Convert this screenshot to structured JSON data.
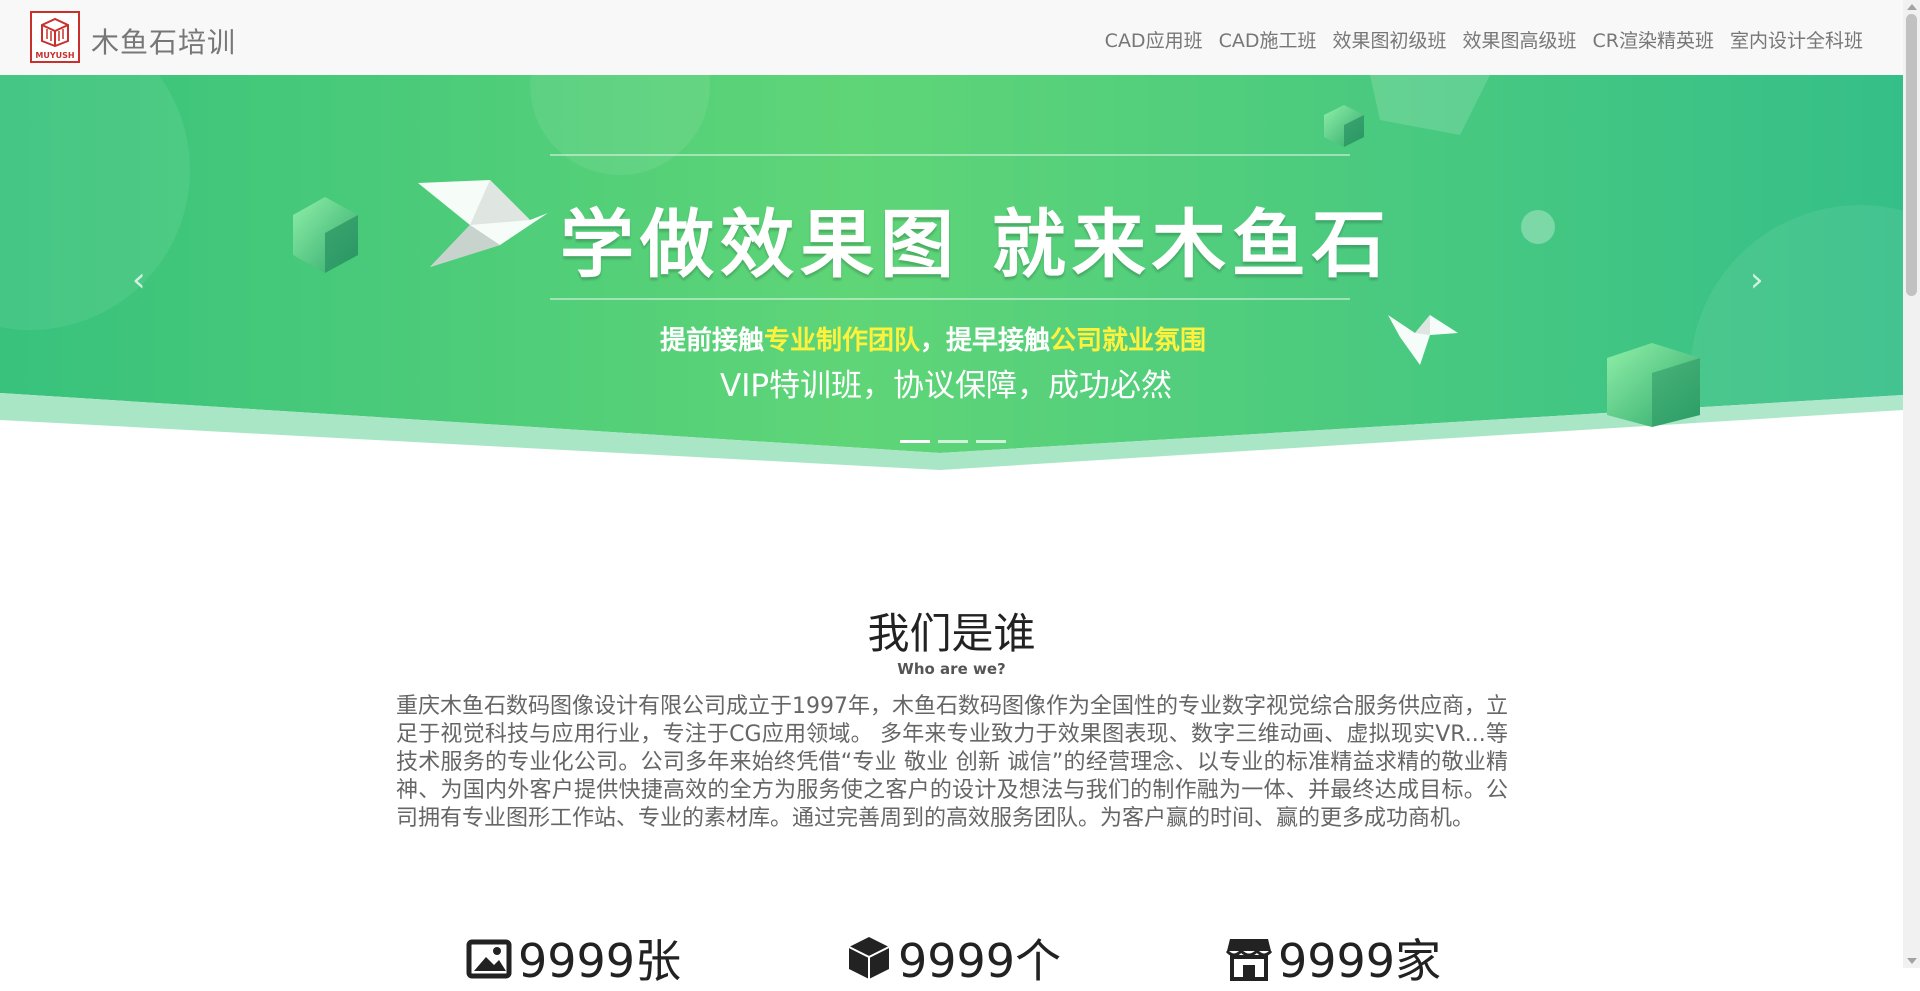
{
  "brand": {
    "name": "木鱼石培训",
    "logo_text": "MUYUSH"
  },
  "nav": {
    "items": [
      "CAD应用班",
      "CAD施工班",
      "效果图初级班",
      "效果图高级班",
      "CR渲染精英班",
      "室内设计全科班"
    ]
  },
  "hero": {
    "title": "学做效果图 就来木鱼石",
    "line1_part1": "提前接触",
    "line1_highlight1": "专业制作团队",
    "line1_part2": "，提早接触",
    "line1_highlight2": "公司就业氛围",
    "line2": "VIP特训班，协议保障，成功必然",
    "prev_icon": "chevron-left-icon",
    "next_icon": "chevron-right-icon",
    "slides_count": 3,
    "active_slide": 1,
    "colors": {
      "green": "#3cc47c",
      "light_green": "#6fdc82",
      "highlight": "#fff23d"
    }
  },
  "about": {
    "title": "我们是谁",
    "subtitle": "Who are we?",
    "text": "重庆木鱼石数码图像设计有限公司成立于1997年，木鱼石数码图像作为全国性的专业数字视觉综合服务供应商，立足于视觉科技与应用行业，专注于CG应用领域。 多年来专业致力于效果图表现、数字三维动画、虚拟现实VR...等技术服务的专业化公司。公司多年来始终凭借“专业 敬业 创新 诚信”的经营理念、以专业的标准精益求精的敬业精神、为国内外客户提供快捷高效的全方为服务使之客户的设计及想法与我们的制作融为一体、并最终达成目标。公司拥有专业图形工作站、专业的素材库。通过完善周到的高效服务团队。为客户赢的时间、赢的更多成功商机。"
  },
  "stats": [
    {
      "icon": "image-icon",
      "value": "9999张"
    },
    {
      "icon": "cube-icon",
      "value": "9999个"
    },
    {
      "icon": "store-icon",
      "value": "9999家"
    }
  ]
}
